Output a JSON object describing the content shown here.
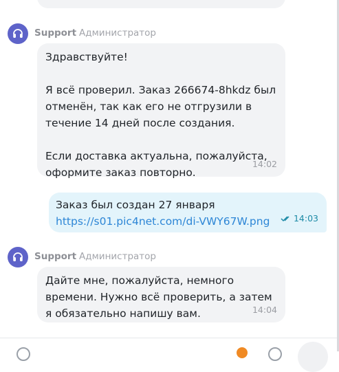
{
  "messages": [
    {
      "sender": "Support",
      "role": "Администратор",
      "paragraphs": [
        "Здравствуйте!",
        "Я всё проверил. Заказ 266674-8hkdz был отменён, так как его не отгрузили в течение 14 дней после создания.",
        "Если доставка актуальна, пожалуйста, оформите заказ повторно."
      ],
      "time": "14:02"
    },
    {
      "text": "Заказ был создан 27 января ",
      "link": "https://s01.pic4net.com/di-VWY67W.png",
      "time": "14:03",
      "status": "read"
    },
    {
      "sender": "Support",
      "role": "Администратор",
      "paragraphs": [
        "Дайте мне, пожалуйста, немного времени. Нужно всё проверить, а затем я обязательно напишу вам."
      ],
      "time": "14:04"
    }
  ],
  "colors": {
    "avatar": "#5e63c9",
    "link": "#2d86d6",
    "read_check": "#1c8aa6",
    "incoming_bubble": "#f2f3f5",
    "outgoing_bubble": "#e3f4fb"
  }
}
